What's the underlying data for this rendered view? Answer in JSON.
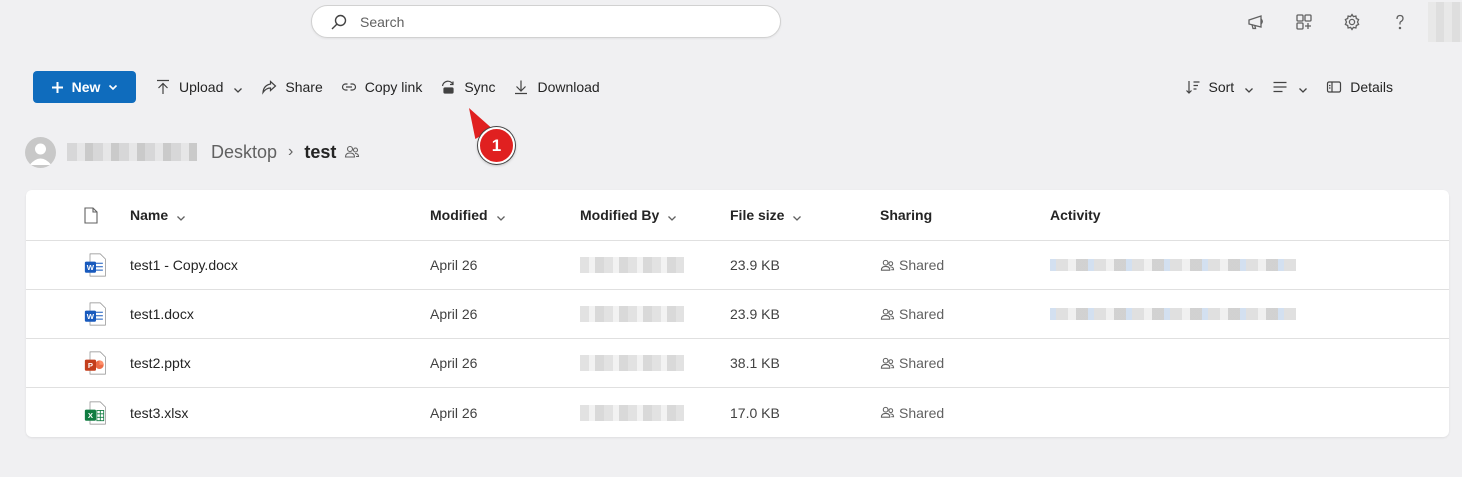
{
  "search": {
    "placeholder": "Search"
  },
  "topbar": {
    "icons": [
      "megaphone-icon",
      "app-switch-icon",
      "gear-icon",
      "help-icon"
    ]
  },
  "commands": {
    "new_label": "New",
    "upload_label": "Upload",
    "share_label": "Share",
    "copy_link_label": "Copy link",
    "sync_label": "Sync",
    "download_label": "Download",
    "sort_label": "Sort",
    "details_label": "Details"
  },
  "annotation": {
    "marker_label": "1"
  },
  "breadcrumb": {
    "items": [
      "Desktop"
    ],
    "current": "test"
  },
  "table": {
    "headers": {
      "name": "Name",
      "modified": "Modified",
      "modified_by": "Modified By",
      "file_size": "File size",
      "sharing": "Sharing",
      "activity": "Activity"
    },
    "rows": [
      {
        "name": "test1 - Copy.docx",
        "type": "word",
        "modified": "April 26",
        "size": "23.9 KB",
        "sharing": "Shared",
        "has_activity": true
      },
      {
        "name": "test1.docx",
        "type": "word",
        "modified": "April 26",
        "size": "23.9 KB",
        "sharing": "Shared",
        "has_activity": true
      },
      {
        "name": "test2.pptx",
        "type": "powerpoint",
        "modified": "April 26",
        "size": "38.1 KB",
        "sharing": "Shared",
        "has_activity": false
      },
      {
        "name": "test3.xlsx",
        "type": "excel",
        "modified": "April 26",
        "size": "17.0 KB",
        "sharing": "Shared",
        "has_activity": false
      }
    ]
  },
  "colors": {
    "accent": "#0f6cbd",
    "word": "#185abd",
    "powerpoint": "#c43e1c",
    "excel": "#107c41",
    "marker": "#e02020"
  }
}
